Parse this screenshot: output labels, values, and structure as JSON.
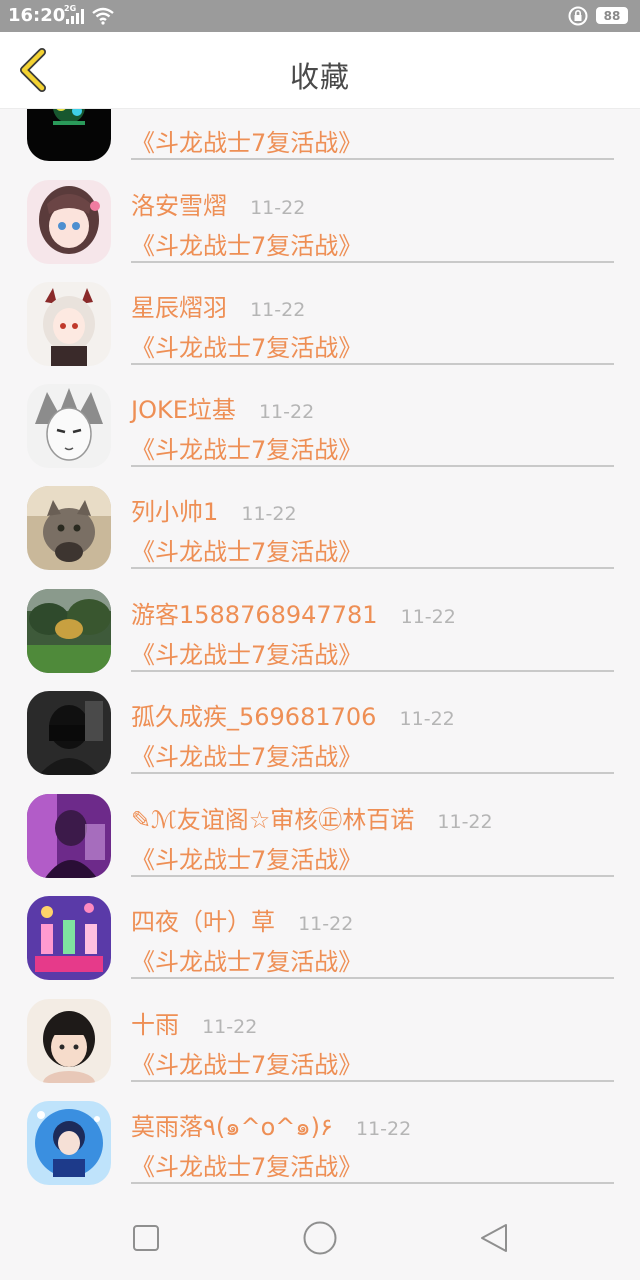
{
  "status_bar": {
    "time": "16:20",
    "network": "2G",
    "battery": "88"
  },
  "header": {
    "title": "收藏"
  },
  "items": [
    {
      "name": "",
      "date": "",
      "book": "《斗龙战士7复活战》",
      "avatar": "night-lights"
    },
    {
      "name": "洛安雪熠",
      "date": "11-22",
      "book": "《斗龙战士7复活战》",
      "avatar": "anime-girl-pink"
    },
    {
      "name": "星辰熠羽",
      "date": "11-22",
      "book": "《斗龙战士7复活战》",
      "avatar": "anime-girl-horns"
    },
    {
      "name": "JOKE垃基",
      "date": "11-22",
      "book": "《斗龙战士7复活战》",
      "avatar": "manga-boy-sketch"
    },
    {
      "name": "列小帅1",
      "date": "11-22",
      "book": "《斗龙战士7复活战》",
      "avatar": "cat-photo"
    },
    {
      "name": "游客1588768947781",
      "date": "11-22",
      "book": "《斗龙战士7复活战》",
      "avatar": "garden-photo"
    },
    {
      "name": "孤久成疾_569681706",
      "date": "11-22",
      "book": "《斗龙战士7复活战》",
      "avatar": "masked-person"
    },
    {
      "name": "✎ℳ友谊阁☆审核㊣林百诺",
      "date": "11-22",
      "book": "《斗龙战士7复活战》",
      "avatar": "purple-girl"
    },
    {
      "name": "四夜（叶）草",
      "date": "11-22",
      "book": "《斗龙战士7复活战》",
      "avatar": "dance-poster"
    },
    {
      "name": "十雨",
      "date": "11-22",
      "book": "《斗龙战士7复活战》",
      "avatar": "little-girl-photo"
    },
    {
      "name": "莫雨落٩(๑^o^๑)۶",
      "date": "11-22",
      "book": "《斗龙战士7复活战》",
      "avatar": "anime-boy-blue"
    }
  ],
  "colors": {
    "accent": "#ee8f55",
    "date": "#b5b5b5",
    "back_arrow": "#f3d232",
    "status_bar": "#9b9b9b"
  }
}
